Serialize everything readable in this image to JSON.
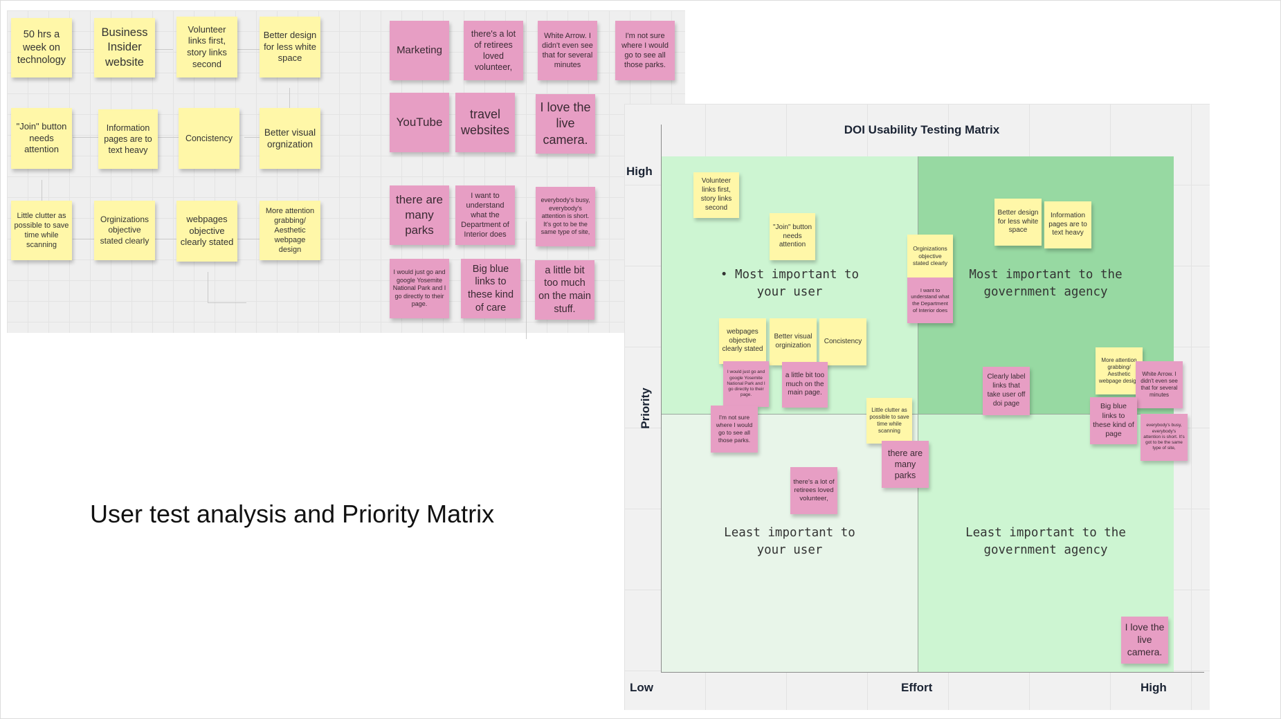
{
  "slide": {
    "title": "User test analysis and Priority Matrix"
  },
  "board": {
    "yellow_notes": [
      "50 hrs a week on technology",
      "Business Insider website",
      "Volunteer links first, story links second",
      "Better design for less white space",
      "\"Join\" button needs attention",
      "Information pages are to text heavy",
      "Concistency",
      "Better visual orgnization",
      "Little clutter as possible to save time while scanning",
      "Orginizations objective stated clearly",
      "webpages objective clearly stated",
      "More attention grabbing/ Aesthetic webpage design"
    ],
    "pink_notes": [
      "Marketing",
      "there's a lot of retirees loved volunteer,",
      "White Arrow. I didn't even see that for several minutes",
      "I'm not sure where I would go to see all those parks.",
      "YouTube",
      "travel websites",
      "I love the live camera.",
      "there are many parks",
      "I want to understand what the Department of Interior does",
      "everybody's busy, everybody's attention is short. It's got to be the same type of site,",
      "I would just go and google Yosemite National Park and I go directly to their page.",
      "Big blue links to these kind of care",
      "a little bit too much on the main stuff."
    ]
  },
  "matrix": {
    "title": "DOI Usability Testing Matrix",
    "y_axis": {
      "label": "Priority",
      "high": "High"
    },
    "x_axis": {
      "label": "Effort",
      "low": "Low",
      "high": "High"
    },
    "quadrants": {
      "top_left": "• Most important to\nyour user",
      "top_right": "Most important to the\ngovernment agency",
      "bottom_left": "Least important to\nyour user",
      "bottom_right": "Least important to the\ngovernment agency"
    },
    "colors": {
      "top_left": "#cdf5d2",
      "top_right": "#97d9a2",
      "bottom_left": "#e8f5e9",
      "bottom_right": "#cdf5d2",
      "sticky_yellow": "#fff7a8",
      "sticky_pink": "#e79ec4"
    },
    "notes": [
      "Volunteer links first, story links second",
      "\"Join\" button needs attention",
      "Orginizations objective stated clearly",
      "I want to understand what the Department of Interior does",
      "Better design for less white space",
      "Information pages are to text heavy",
      "webpages objective clearly stated",
      "Better visual orginization",
      "Concistency",
      "I would just go and google Yosemite National Park and I go directly to their page.",
      "a little bit too much on the main page.",
      "I'm not sure where I would go to see all those parks.",
      "Little clutter as possible to save time while scanning",
      "there are many parks",
      "Clearly label links that take user off doi page",
      "More attention grabbing/ Aesthetic webpage design",
      "White Arrow. I didn't even see that for several minutes",
      "Big blue links to these kind of page",
      "everybody's busy, everybody's attention is short. It's got to be the same type of site,",
      "there's a lot of retirees loved volunteer,",
      "I love the live camera."
    ]
  }
}
